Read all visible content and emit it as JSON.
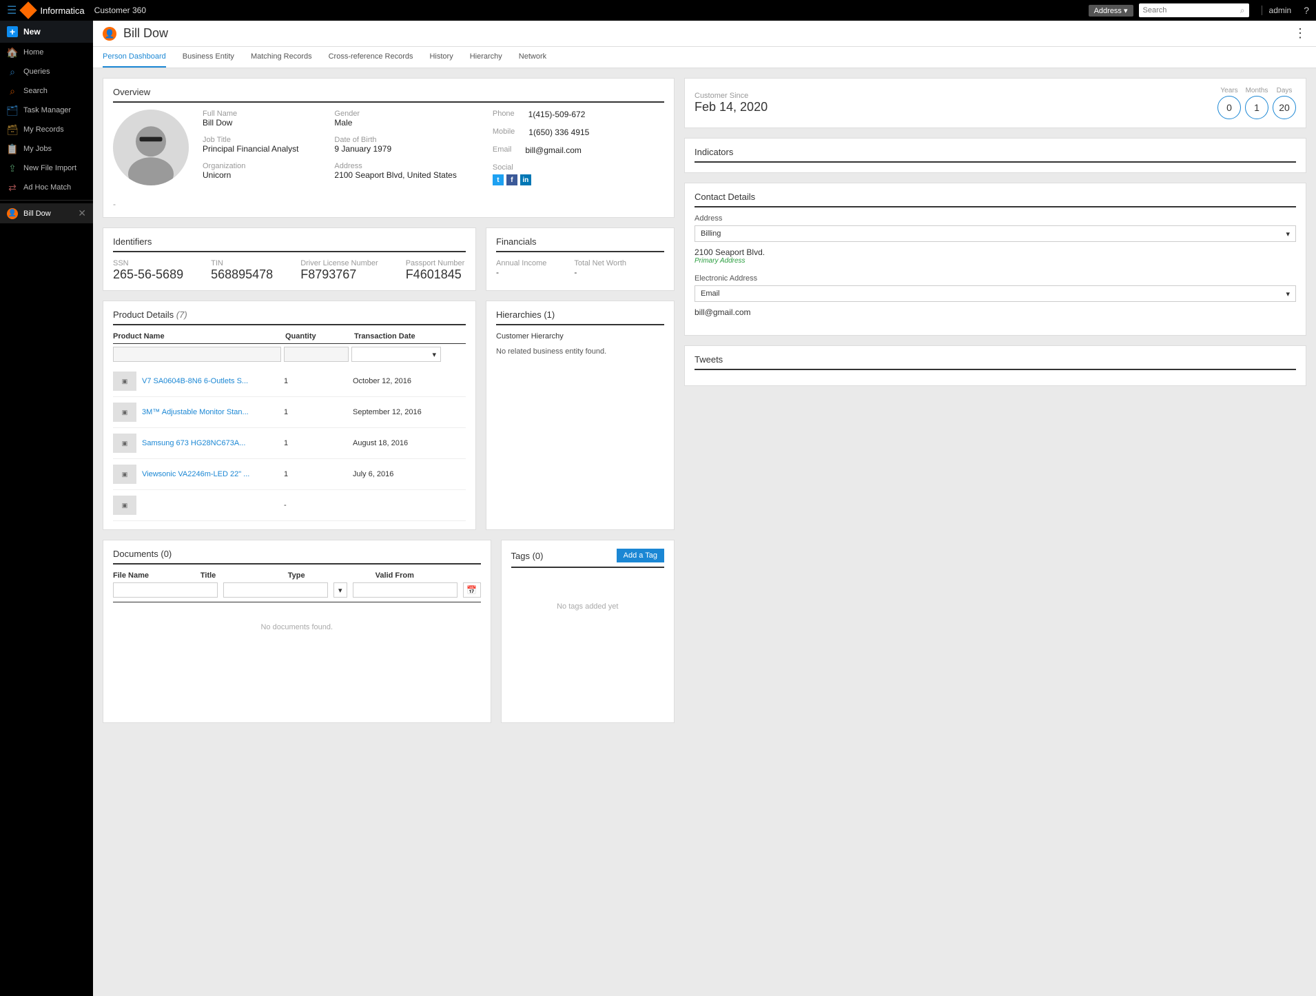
{
  "header": {
    "brand": "Informatica",
    "app_title": "Customer 360",
    "search_scope": "Address ▾",
    "search_placeholder": "Search",
    "admin_label": "admin"
  },
  "sidebar": {
    "new_label": "New",
    "items": [
      {
        "label": "Home"
      },
      {
        "label": "Queries"
      },
      {
        "label": "Search"
      },
      {
        "label": "Task Manager"
      },
      {
        "label": "My Records"
      },
      {
        "label": "My Jobs"
      },
      {
        "label": "New File Import"
      },
      {
        "label": "Ad Hoc Match"
      }
    ],
    "active_record": "Bill Dow"
  },
  "record": {
    "name": "Bill Dow"
  },
  "tabs": [
    {
      "label": "Person Dashboard",
      "active": true
    },
    {
      "label": "Business Entity"
    },
    {
      "label": "Matching Records"
    },
    {
      "label": "Cross-reference Records"
    },
    {
      "label": "History"
    },
    {
      "label": "Hierarchy"
    },
    {
      "label": "Network"
    }
  ],
  "overview": {
    "section_title": "Overview",
    "full_name_label": "Full Name",
    "full_name": "Bill Dow",
    "job_title_label": "Job Title",
    "job_title": "Principal Financial Analyst",
    "organization_label": "Organization",
    "organization": "Unicorn",
    "gender_label": "Gender",
    "gender": "Male",
    "dob_label": "Date of Birth",
    "dob": "9 January 1979",
    "address_label": "Address",
    "address": "2100 Seaport Blvd, United States",
    "phone_label": "Phone",
    "phone": "1(415)-509-672",
    "mobile_label": "Mobile",
    "mobile": "1(650) 336 4915",
    "email_label": "Email",
    "email": "bill@gmail.com",
    "social_label": "Social"
  },
  "identifiers": {
    "title": "Identifiers",
    "ssn_label": "SSN",
    "ssn": "265-56-5689",
    "tin_label": "TIN",
    "tin": "568895478",
    "dln_label": "Driver License Number",
    "dln": "F8793767",
    "passport_label": "Passport Number",
    "passport": "F4601845"
  },
  "financials": {
    "title": "Financials",
    "income_label": "Annual Income",
    "income": "-",
    "networth_label": "Total Net Worth",
    "networth": "-"
  },
  "products": {
    "title": "Product Details",
    "count": "(7)",
    "col_name": "Product Name",
    "col_qty": "Quantity",
    "col_date": "Transaction Date",
    "rows": [
      {
        "name": "V7 SA0604B-8N6 6-Outlets S...",
        "qty": "1",
        "date": "October 12, 2016"
      },
      {
        "name": "3M™ Adjustable Monitor Stan...",
        "qty": "1",
        "date": "September 12, 2016"
      },
      {
        "name": "Samsung 673 HG28NC673A...",
        "qty": "1",
        "date": "August 18, 2016"
      },
      {
        "name": "Viewsonic VA2246m-LED 22\" ...",
        "qty": "1",
        "date": "July 6, 2016"
      },
      {
        "name": "",
        "qty": "-",
        "date": ""
      }
    ]
  },
  "documents": {
    "title": "Documents (0)",
    "col_file": "File Name",
    "col_title": "Title",
    "col_type": "Type",
    "col_valid": "Valid From",
    "no_docs": "No documents found."
  },
  "tags": {
    "title": "Tags (0)",
    "add_btn": "Add a Tag",
    "empty": "No tags added yet"
  },
  "hierarchies": {
    "title": "Hierarchies (1)",
    "subtitle": "Customer Hierarchy",
    "msg": "No related business entity found."
  },
  "customer_since": {
    "label": "Customer Since",
    "date": "Feb 14, 2020",
    "years_label": "Years",
    "years": "0",
    "months_label": "Months",
    "months": "1",
    "days_label": "Days",
    "days": "20"
  },
  "indicators": {
    "title": "Indicators"
  },
  "contact_details": {
    "title": "Contact Details",
    "address_label": "Address",
    "address_type": "Billing",
    "address_line": "2100 Seaport Blvd.",
    "primary_tag": "Primary Address",
    "elec_label": "Electronic Address",
    "elec_type": "Email",
    "elec_value": "bill@gmail.com"
  },
  "tweets": {
    "title": "Tweets"
  }
}
